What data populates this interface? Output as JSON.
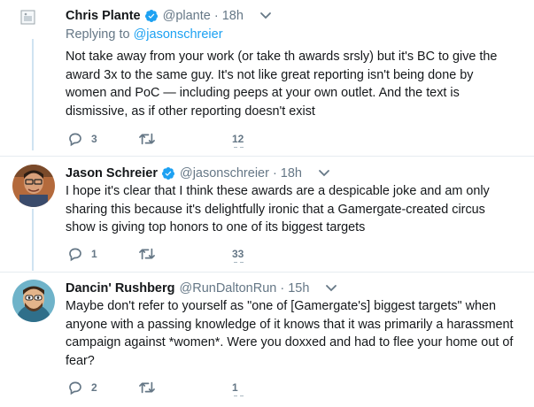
{
  "colors": {
    "accent": "#1da1f2",
    "text": "#14171a",
    "muted": "#657786",
    "thread_line": "#cfe3f1",
    "divider": "#e6ecf0"
  },
  "tweets": [
    {
      "name": "Chris Plante",
      "verified": true,
      "handle": "@plante",
      "separator": "·",
      "time": "18h",
      "replying_label": "Replying to",
      "replying_handle": "@jasonschreier",
      "text": "Not take away from your work (or take th awards srsly) but it's BC to give the award 3x to the same guy. It's not like great reporting isn't being done by women and PoC — including peeps at your own outlet. And the text is dismissive, as if other reporting doesn't exist",
      "replies": "3",
      "retweets": "",
      "likes": "12",
      "avatar_icon": "broken-image-icon"
    },
    {
      "name": "Jason Schreier",
      "verified": true,
      "handle": "@jasonschreier",
      "separator": "·",
      "time": "18h",
      "text": "I hope it's clear that I think these awards are a despicable joke and am only sharing this because it's delightfully ironic that a Gamergate-created circus show is giving top honors to one of its biggest targets",
      "replies": "1",
      "retweets": "",
      "likes": "33",
      "avatar_icon": "person-photo-avatar"
    },
    {
      "name": "Dancin' Rushberg",
      "verified": false,
      "handle": "@RunDaltonRun",
      "separator": "·",
      "time": "15h",
      "text": "Maybe don't refer to yourself as \"one of [Gamergate's] biggest targets\" when anyone with a passing knowledge of it knows that it was primarily a harassment campaign against *women*. Were you doxxed and had to flee your home out of fear?",
      "replies": "2",
      "retweets": "",
      "likes": "1",
      "avatar_icon": "cartoon-character-avatar"
    }
  ]
}
